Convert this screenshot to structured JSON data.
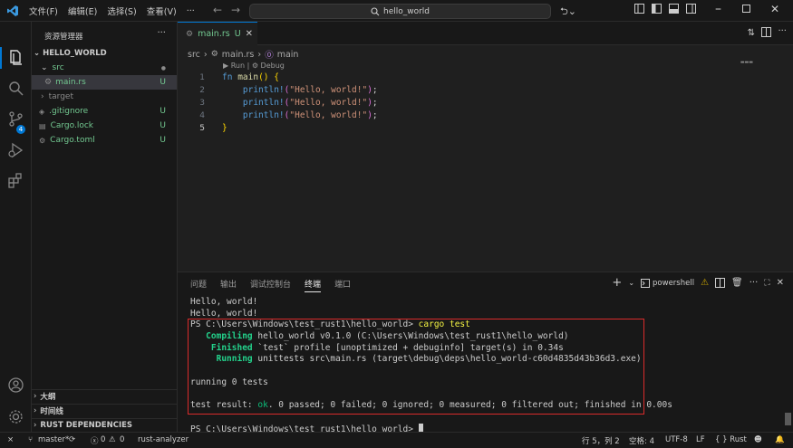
{
  "menu": {
    "items": [
      "文件(F)",
      "编辑(E)",
      "选择(S)",
      "查看(V)",
      "···"
    ]
  },
  "search": {
    "text": "hello_world"
  },
  "explorer": {
    "title": "资源管理器",
    "folder": "HELLO_WORLD",
    "items": [
      {
        "label": "src",
        "badge": "●"
      },
      {
        "label": "main.rs",
        "badge": "U"
      },
      {
        "label": "target",
        "badge": ""
      },
      {
        "label": ".gitignore",
        "badge": "U"
      },
      {
        "label": "Cargo.lock",
        "badge": "U"
      },
      {
        "label": "Cargo.toml",
        "badge": "U"
      }
    ],
    "sections": [
      "大纲",
      "时间线",
      "RUST DEPENDENCIES"
    ]
  },
  "tab": {
    "label": "main.rs",
    "status": "U"
  },
  "breadcrumb": {
    "folder": "src",
    "file": "main.rs",
    "symbol": "main"
  },
  "codelens": "▶ Run | ⚙ Debug",
  "code": {
    "line_numbers": [
      "1",
      "2",
      "3",
      "4",
      "5"
    ],
    "println_arg": "\"Hello, world!\""
  },
  "panel": {
    "tabs": [
      "问题",
      "输出",
      "调试控制台",
      "终端",
      "端口"
    ],
    "active_tab": "终端",
    "shell": "powershell"
  },
  "terminal": {
    "lines": {
      "l0": "Hello, world!",
      "l1": "Hello, world!",
      "l2_prompt": "PS C:\\Users\\Windows\\test_rust1\\hello_world> ",
      "l2_cmd": "cargo test",
      "l3_tag": "   Compiling",
      "l3_rest": " hello_world v0.1.0 (C:\\Users\\Windows\\test_rust1\\hello_world)",
      "l4_tag": "    Finished",
      "l4_rest": " `test` profile [unoptimized + debuginfo] target(s) in 0.34s",
      "l5_tag": "     Running",
      "l5_rest": " unittests src\\main.rs (target\\debug\\deps\\hello_world-c60d4835d43b36d3.exe)",
      "l6": "",
      "l7": "running 0 tests",
      "l8": "",
      "l9_a": "test result: ",
      "l9_ok": "ok",
      "l9_b": ". 0 passed; 0 failed; 0 ignored; 0 measured; 0 filtered out; finished in 0.00s",
      "l10": "",
      "l11": "PS C:\\Users\\Windows\\test_rust1\\hello_world> "
    }
  },
  "status": {
    "branch": "master*",
    "errors": "0",
    "warnings": "0",
    "extension": "rust-analyzer",
    "position": "行 5，列 2",
    "spaces": "空格: 4",
    "encoding": "UTF-8",
    "eol": "LF",
    "language": "{ } Rust"
  },
  "colors": {
    "accent": "#0078d4",
    "highlight_box": "#d92b2b",
    "untracked": "#73c991"
  }
}
